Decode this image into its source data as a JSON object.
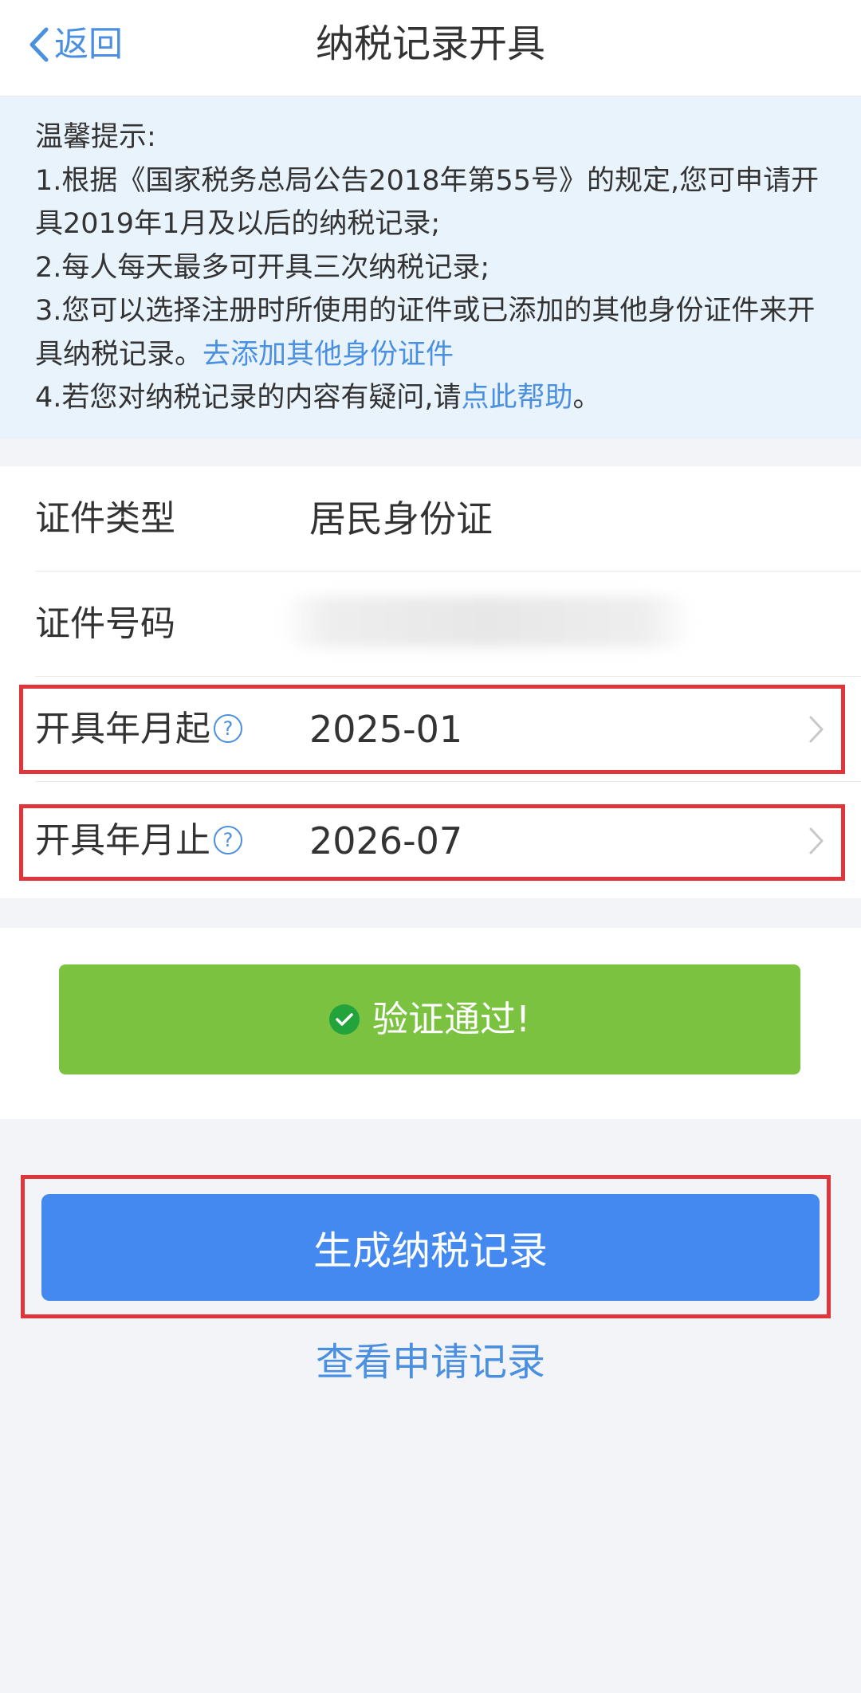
{
  "navbar": {
    "back_label": "返回",
    "title": "纳税记录开具"
  },
  "notice": {
    "title": "温馨提示:",
    "item1": "1.根据《国家税务总局公告2018年第55号》的规定,您可申请开具2019年1月及以后的纳税记录;",
    "item2": "2.每人每天最多可开具三次纳税记录;",
    "item3_text": "3.您可以选择注册时所使用的证件或已添加的其他身份证件来开具纳税记录。",
    "item3_link": "去添加其他身份证件",
    "item4_text": "4.若您对纳税记录的内容有疑问,请",
    "item4_link": "点此帮助",
    "item4_end": "。"
  },
  "form": {
    "id_type_label": "证件类型",
    "id_type_value": "居民身份证",
    "id_number_label": "证件号码",
    "start_label": "开具年月起",
    "start_value": "2025-01",
    "end_label": "开具年月止",
    "end_value": "2026-07",
    "help_glyph": "?"
  },
  "verify": {
    "text": "验证通过!"
  },
  "actions": {
    "generate_label": "生成纳税记录",
    "history_label": "查看申请记录"
  },
  "colors": {
    "accent_blue": "#4a8fe0",
    "button_blue": "#4389f0",
    "success_green": "#7bc241",
    "highlight_red": "#e0353b",
    "notice_bg": "#e8f3fc"
  },
  "icons": {
    "back": "chevron-left-icon",
    "help": "question-circle-icon",
    "arrow": "chevron-right-icon",
    "check": "check-circle-icon"
  }
}
